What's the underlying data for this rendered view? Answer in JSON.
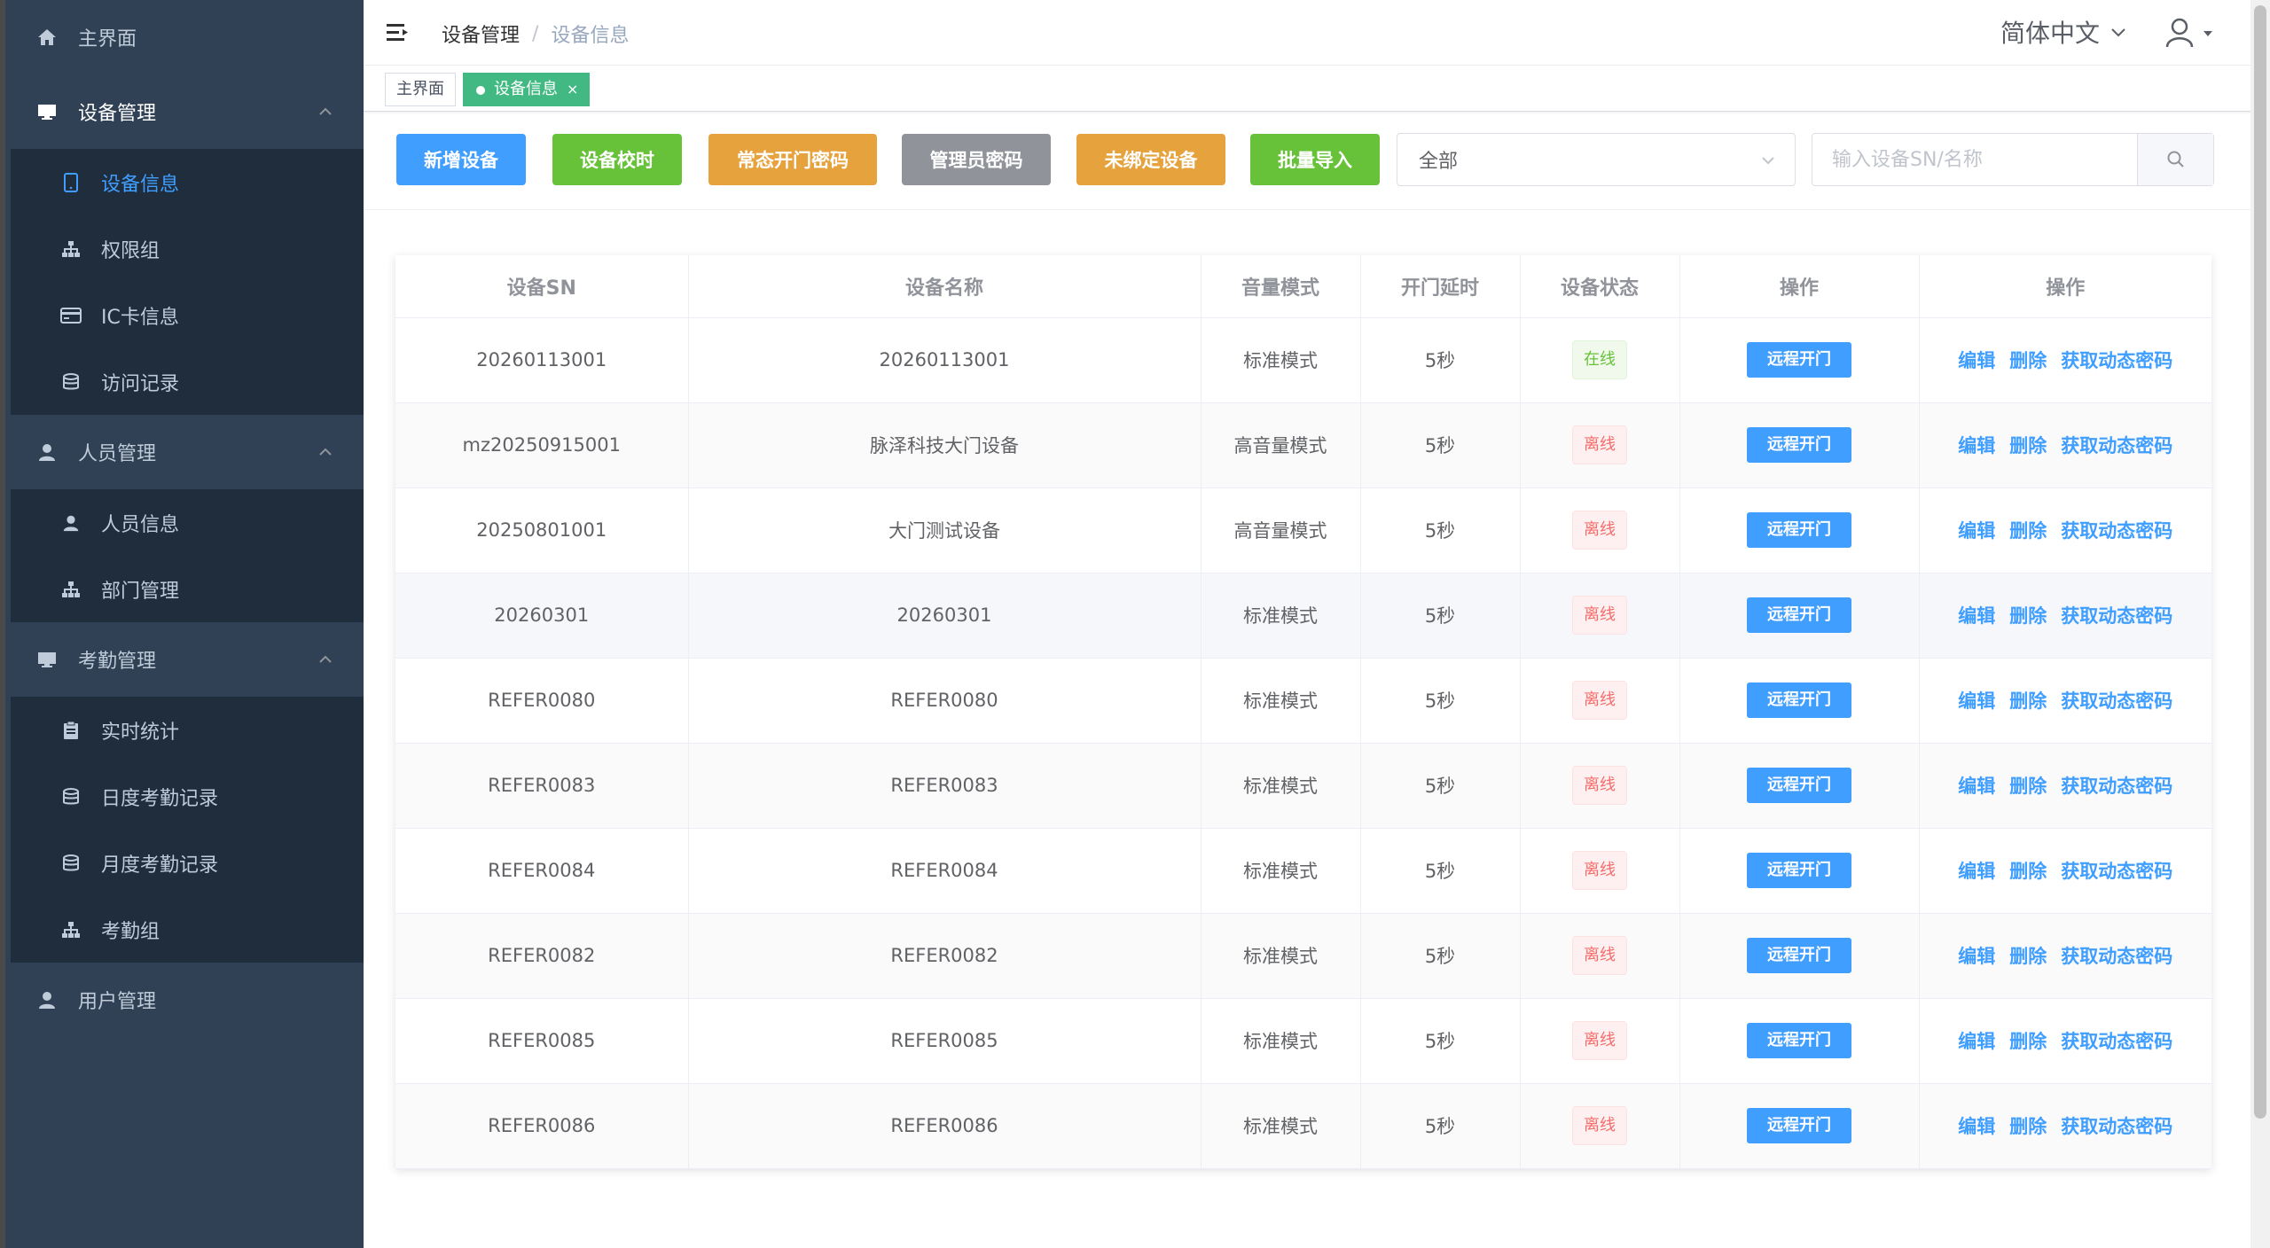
{
  "sidebar": {
    "home": "主界面",
    "device_mgmt": "设备管理",
    "device_items": [
      "设备信息",
      "权限组",
      "IC卡信息",
      "访问记录"
    ],
    "people_mgmt": "人员管理",
    "people_items": [
      "人员信息",
      "部门管理"
    ],
    "attendance_mgmt": "考勤管理",
    "attendance_items": [
      "实时统计",
      "日度考勤记录",
      "月度考勤记录",
      "考勤组"
    ],
    "user_mgmt": "用户管理"
  },
  "header": {
    "breadcrumb_parent": "设备管理",
    "breadcrumb_current": "设备信息",
    "language": "简体中文"
  },
  "tags": {
    "home": "主界面",
    "current": "设备信息",
    "close": "×"
  },
  "toolbar": {
    "add": "新增设备",
    "sync_time": "设备校时",
    "open_pwd": "常态开门密码",
    "admin_pwd": "管理员密码",
    "unbound": "未绑定设备",
    "batch_import": "批量导入",
    "filter_value": "全部",
    "search_placeholder": "输入设备SN/名称"
  },
  "colors": {
    "primary": "#409eff",
    "success": "#67c23a",
    "warning": "#e6a23c",
    "info": "#909399",
    "sidebar": "#304156"
  },
  "table": {
    "headers": [
      "设备SN",
      "设备名称",
      "音量模式",
      "开门延时",
      "设备状态",
      "操作",
      "操作"
    ],
    "open_label": "远程开门",
    "edit_label": "编辑",
    "delete_label": "删除",
    "dynpwd_label": "获取动态密码",
    "rows": [
      {
        "sn": "20260113001",
        "name": "20260113001",
        "volume": "标准模式",
        "delay": "5秒",
        "status": "在线"
      },
      {
        "sn": "mz20250915001",
        "name": "脉泽科技大门设备",
        "volume": "高音量模式",
        "delay": "5秒",
        "status": "离线"
      },
      {
        "sn": "20250801001",
        "name": "大门测试设备",
        "volume": "高音量模式",
        "delay": "5秒",
        "status": "离线"
      },
      {
        "sn": "20260301",
        "name": "20260301",
        "volume": "标准模式",
        "delay": "5秒",
        "status": "离线"
      },
      {
        "sn": "REFER0080",
        "name": "REFER0080",
        "volume": "标准模式",
        "delay": "5秒",
        "status": "离线"
      },
      {
        "sn": "REFER0083",
        "name": "REFER0083",
        "volume": "标准模式",
        "delay": "5秒",
        "status": "离线"
      },
      {
        "sn": "REFER0084",
        "name": "REFER0084",
        "volume": "标准模式",
        "delay": "5秒",
        "status": "离线"
      },
      {
        "sn": "REFER0082",
        "name": "REFER0082",
        "volume": "标准模式",
        "delay": "5秒",
        "status": "离线"
      },
      {
        "sn": "REFER0085",
        "name": "REFER0085",
        "volume": "标准模式",
        "delay": "5秒",
        "status": "离线"
      },
      {
        "sn": "REFER0086",
        "name": "REFER0086",
        "volume": "标准模式",
        "delay": "5秒",
        "status": "离线"
      }
    ]
  }
}
